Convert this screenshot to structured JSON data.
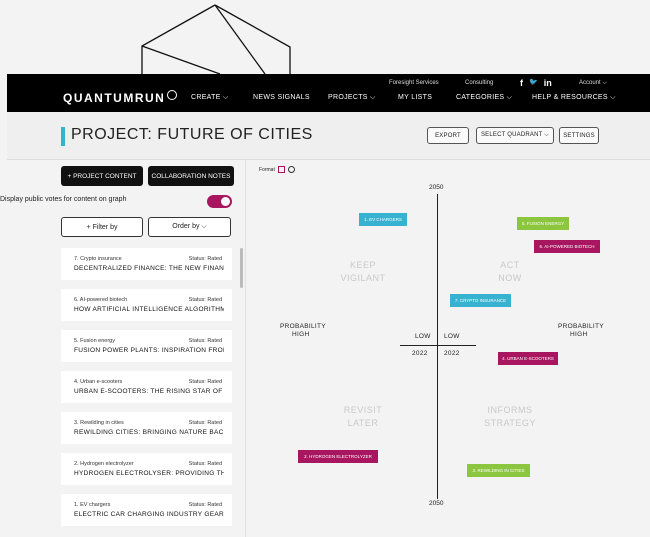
{
  "colors": {
    "accent": "#37b3d1",
    "magenta": "#a81660",
    "green": "#8cc63f",
    "dark": "#000000"
  },
  "header": {
    "logo": "QUANTUMRUN",
    "nav": {
      "create": "CREATE ⌵",
      "signals": "NEWS SIGNALS",
      "projects": "PROJECTS ⌵",
      "mylists": "MY LISTS",
      "categories": "CATEGORIES ⌵",
      "help": "HELP & RESOURCES ⌵"
    },
    "top_links": {
      "foresight": "Foresight Services",
      "consulting": "Consulting",
      "account": "Account ⌵"
    },
    "social": {
      "facebook": "f",
      "twitter": "🐦",
      "linkedin": "in"
    }
  },
  "project": {
    "title": "PROJECT: FUTURE OF CITIES",
    "buttons": {
      "export": "EXPORT",
      "quadrant": "SELECT QUADRANT ⌵",
      "settings": "SETTINGS"
    }
  },
  "sidebar": {
    "content_btn": "+ PROJECT CONTENT",
    "notes_btn": "COLLABORATION NOTES",
    "toggle_label": "Display public votes for content on graph",
    "filter": "+ Filter by",
    "order": "Order by ⌵",
    "cards": [
      {
        "cat": "7. Crypto insurance",
        "status": "Status: Rated",
        "title": "DECENTRALIZED FINANCE: THE NEW FINANCE..."
      },
      {
        "cat": "6. AI-powered biotech",
        "status": "Status: Rated",
        "title": "HOW ARTIFICIAL INTELLIGENCE ALGORITHMS..."
      },
      {
        "cat": "5. Fusion energy",
        "status": "Status: Rated",
        "title": "FUSION POWER PLANTS: INSPIRATION FROM THE..."
      },
      {
        "cat": "4. Urban e-scooters",
        "status": "Status: Rated",
        "title": "URBAN E-SCOOTERS: THE RISING STAR OF URBAN..."
      },
      {
        "cat": "3. Rewilding in cities",
        "status": "Status: Rated",
        "title": "REWILDING CITIES: BRINGING NATURE BACK INTO..."
      },
      {
        "cat": "2. Hydrogen electrolyzer",
        "status": "Status: Rated",
        "title": "HYDROGEN ELECTROLYSER: PROVIDING THE FUEL..."
      },
      {
        "cat": "1. EV chargers",
        "status": "Status: Rated",
        "title": "ELECTRIC CAR CHARGING INDUSTRY GEARS UP..."
      }
    ]
  },
  "chart": {
    "format_label": "Format",
    "year_top": "2050",
    "year_bottom": "2050",
    "year_left": "2022",
    "year_right": "2022",
    "prob_left": [
      "PROBABILITY",
      "HIGH"
    ],
    "prob_right": [
      "PROBABILITY",
      "HIGH"
    ],
    "low_left": "LOW",
    "low_right": "LOW",
    "quadrants": {
      "keep": [
        "KEEP",
        "VIGILANT"
      ],
      "act": [
        "ACT",
        "NOW"
      ],
      "revisit": [
        "REVISIT",
        "LATER"
      ],
      "informs": [
        "INFORMS",
        "STRATEGY"
      ]
    },
    "chips": {
      "ev": "1. EV CHARGERS",
      "fusion": "5. FUSION ENERGY",
      "biotech": "6. AI-POWERED BIOTECH",
      "crypto": "7. CRYPTO INSURANCE",
      "scooters": "4. URBAN E-SCOOTERS",
      "hydrogen": "2. HYDROGEN ELECTROLYZER",
      "rewilding": "3. REWILDING IN CITIES"
    }
  }
}
